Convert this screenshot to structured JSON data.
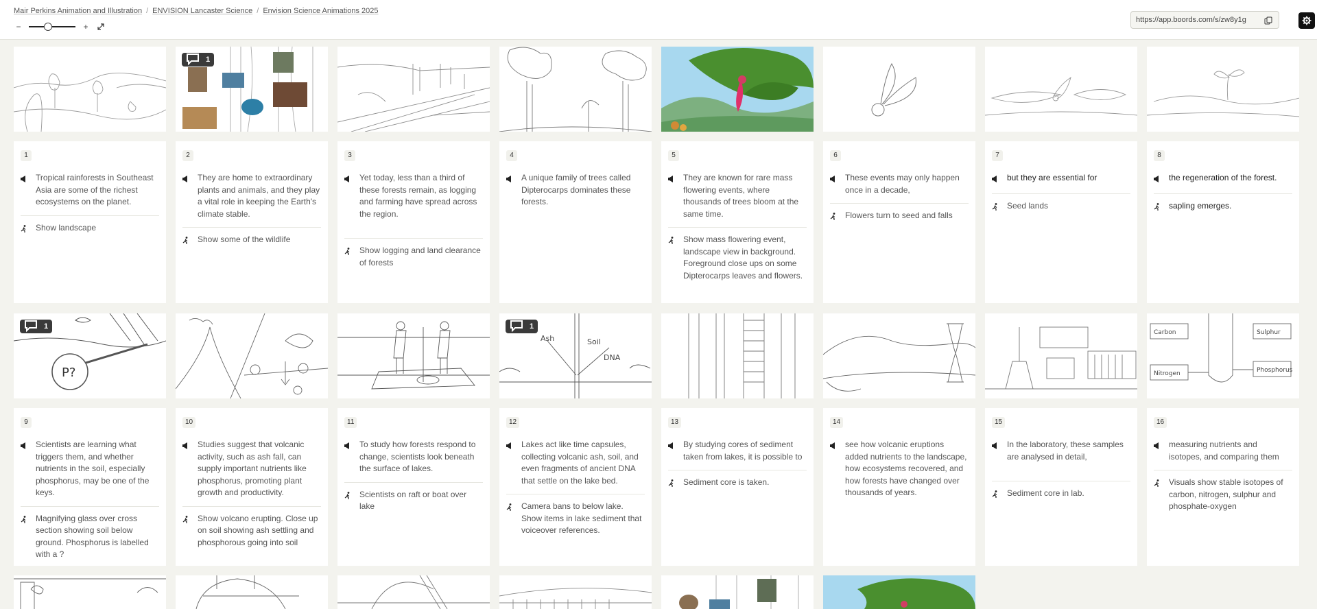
{
  "breadcrumb": [
    "Mair Perkins Animation and Illustration",
    "ENVISION Lancaster Science",
    "Envision Science Animations 2025"
  ],
  "zoom": {
    "minus": "−",
    "plus": "+",
    "value": 0.4,
    "fullscreen_icon": "expand-icon"
  },
  "share": {
    "url": "https://app.boords.com/s/zw8y1g",
    "copy_icon": "copy-icon",
    "settings_icon": "gear-icon"
  },
  "frames": [
    {
      "number": "1",
      "voiceover": "Tropical rainforests in Southeast Asia are some of the richest ecosystems on the planet.",
      "action": "Show landscape",
      "comments": null
    },
    {
      "number": "2",
      "voiceover": "They are home to extraordinary plants and animals, and they play a vital role in keeping the Earth's climate stable.",
      "action": "Show some of the wildlife",
      "comments": "1"
    },
    {
      "number": "3",
      "voiceover": "Yet today, less than a third of these forests remain, as logging and farming have spread across the region.",
      "action": "Show logging and land clearance of forests",
      "comments": null
    },
    {
      "number": "4",
      "voiceover": "A unique family of trees called Dipterocarps dominates these forests.",
      "action": "",
      "comments": null
    },
    {
      "number": "5",
      "voiceover": "They are known for rare mass flowering events, where thousands of trees bloom at the same time.",
      "action": "Show mass flowering event, landscape view in background. Foreground close ups on some Dipterocarps leaves and flowers.",
      "comments": null
    },
    {
      "number": "6",
      "voiceover": "These events may only happen once in a decade,",
      "action": "Flowers turn to seed and falls",
      "comments": null
    },
    {
      "number": "7",
      "voiceover": "but they are essential for",
      "action": "Seed lands",
      "comments": null
    },
    {
      "number": "8",
      "voiceover": "the regeneration of the forest.",
      "action": "sapling emerges.",
      "comments": null
    },
    {
      "number": "9",
      "voiceover": "Scientists are learning what triggers them, and whether nutrients in the soil, especially phosphorus, may be one of the keys.",
      "action": "Magnifying glass over cross section showing soil below ground. Phosphorus is labelled with a ?",
      "comments": "1"
    },
    {
      "number": "10",
      "voiceover": "Studies suggest that volcanic activity, such as ash fall, can supply important nutrients like phosphorus, promoting plant growth and productivity.",
      "action": "Show volcano erupting. Close up on soil showing ash settling and phosphorous going into soil",
      "comments": null
    },
    {
      "number": "11",
      "voiceover": "To study how forests respond to change, scientists look beneath the surface of lakes.",
      "action": "Scientists on raft or boat over lake",
      "comments": null
    },
    {
      "number": "12",
      "voiceover": "Lakes act like time capsules, collecting volcanic ash, soil, and even fragments of ancient DNA that settle on the lake bed.",
      "action": "Camera bans to below lake. Show items in lake sediment that voiceover references.",
      "comments": "1"
    },
    {
      "number": "13",
      "voiceover": "By studying cores of sediment taken from lakes, it is possible to",
      "action": "Sediment core is taken.",
      "comments": null
    },
    {
      "number": "14",
      "voiceover": "see how volcanic eruptions added nutrients to the landscape, how ecosystems recovered, and how forests have changed over thousands of years.",
      "action": "",
      "comments": null
    },
    {
      "number": "15",
      "voiceover": "In the laboratory, these samples are analysed in detail,",
      "action": "Sediment core in lab.",
      "comments": null
    },
    {
      "number": "16",
      "voiceover": "measuring nutrients and isotopes, and comparing them",
      "action": "Visuals show stable isotopes of carbon, nitrogen, sulphur and phosphate-oxygen",
      "comments": null
    }
  ],
  "sketch_labels": {
    "f9": "P?",
    "f12": [
      "Ash",
      "Soil",
      "DNA"
    ],
    "f16": [
      "Carbon",
      "Sulphur",
      "Nitrogen",
      "Phosphorus"
    ]
  }
}
